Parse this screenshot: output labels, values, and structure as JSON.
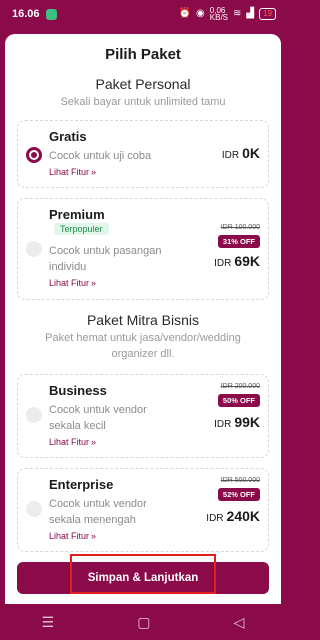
{
  "status_bar": {
    "time": "16.06",
    "net_speed": "0,06\nKB/S",
    "battery": "19"
  },
  "sheet": {
    "title": "Pilih Paket"
  },
  "sections": {
    "personal": {
      "title": "Paket Personal",
      "subtitle": "Sekali bayar untuk unlimited tamu"
    },
    "business": {
      "title": "Paket Mitra Bisnis",
      "subtitle": "Paket hemat untuk jasa/vendor/wedding organizer dll."
    }
  },
  "plans": {
    "gratis": {
      "name": "Gratis",
      "desc": "Cocok untuk uji coba",
      "link": "Lihat Fitur",
      "currency": "IDR",
      "price": "0K",
      "selected": true
    },
    "premium": {
      "name": "Premium",
      "badge": "Terpopuler",
      "desc": "Cocok untuk pasangan individu",
      "link": "Lihat Fitur",
      "original": "IDR 100.000",
      "discount": "31% OFF",
      "currency": "IDR",
      "price": "69K",
      "selected": false
    },
    "business": {
      "name": "Business",
      "desc": "Cocok untuk vendor sekala kecil",
      "link": "Lihat Fitur",
      "original": "IDR 200.000",
      "discount": "50% OFF",
      "currency": "IDR",
      "price": "99K",
      "selected": false
    },
    "enterprise": {
      "name": "Enterprise",
      "desc": "Cocok untuk vendor sekala menengah",
      "link": "Lihat Fitur",
      "original": "IDR 500.000",
      "discount": "52% OFF",
      "currency": "IDR",
      "price": "240K",
      "selected": false
    }
  },
  "cta": {
    "label": "Simpan & Lanjutkan"
  },
  "colors": {
    "brand": "#8a0a4a",
    "badge_green": "#1e8a4a",
    "highlight": "#e02020"
  },
  "icons": {
    "nav_menu": "menu-icon",
    "nav_home": "home-icon",
    "nav_back": "back-icon"
  }
}
